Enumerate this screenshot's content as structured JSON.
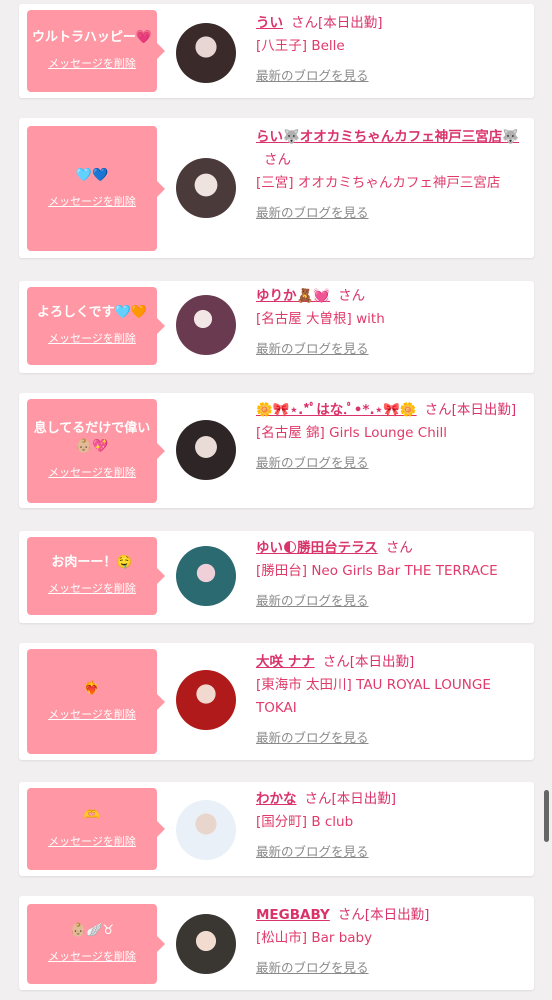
{
  "cards": [
    {
      "message": "ウルトラハッピー💗",
      "delete_label": "メッセージを削除",
      "name": "うい",
      "honorific": "さん[本日出勤]",
      "location": "[八王子] Belle",
      "blog_label": "最新のブログを見る"
    },
    {
      "message": "🩵💙",
      "delete_label": "メッセージを削除",
      "name": "らい🐺オオカミちゃんカフェ神戸三宮店🐺",
      "honorific": "さん",
      "location": "[三宮] オオカミちゃんカフェ神戸三宮店",
      "blog_label": "最新のブログを見る"
    },
    {
      "message": "よろしくです🩵🧡",
      "delete_label": "メッセージを削除",
      "name": "ゆりか🧸💓",
      "honorific": "さん",
      "location": "[名古屋 大曽根] with",
      "blog_label": "最新のブログを見る"
    },
    {
      "message": "息してるだけで偉い👶🏼💖",
      "delete_label": "メッセージを削除",
      "name": "🌼🎀⋆.*ﾟはな.ﾟ•*.⋆🎀🌼",
      "honorific": "さん[本日出勤]",
      "location": "[名古屋 錦] Girls Lounge Chill",
      "blog_label": "最新のブログを見る"
    },
    {
      "message": "お肉ーー！🤤",
      "delete_label": "メッセージを削除",
      "name": "ゆい🌓勝田台テラス",
      "honorific": "さん",
      "location": "[勝田台] Neo Girls Bar THE TERRACE",
      "blog_label": "最新のブログを見る"
    },
    {
      "message": "❤️‍🔥",
      "delete_label": "メッセージを削除",
      "name": "大咲 ナナ",
      "honorific": "さん[本日出勤]",
      "location": "[東海市 太田川] TAU ROYAL LOUNGE TOKAI",
      "blog_label": "最新のブログを見る"
    },
    {
      "message": "🫶",
      "delete_label": "メッセージを削除",
      "name": "わかな",
      "honorific": "さん[本日出勤]",
      "location": "[国分町] B club",
      "blog_label": "最新のブログを見る"
    },
    {
      "message": "👶🏼🪽♉",
      "delete_label": "メッセージを削除",
      "name": "MEGBABY",
      "honorific": "さん[本日出勤]",
      "location": "[松山市] Bar baby",
      "blog_label": "最新のブログを見る"
    }
  ],
  "colors": {
    "bubble": "#ff98a4",
    "name": "#d9336a",
    "blog_link": "#8a8a8a",
    "background": "#f1eff0"
  }
}
